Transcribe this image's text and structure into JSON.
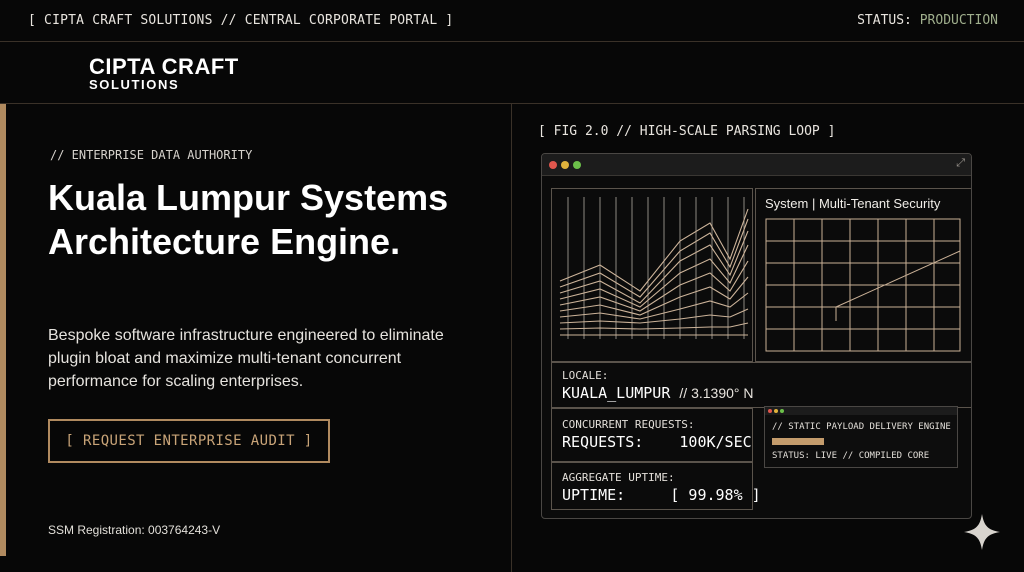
{
  "topbar": {
    "breadcrumb": "[ CIPTA CRAFT SOLUTIONS // CENTRAL CORPORATE PORTAL ]",
    "status_label": "STATUS:",
    "status_value": "PRODUCTION"
  },
  "logo": {
    "main": "CIPTA CRAFT",
    "sub": "SOLUTIONS"
  },
  "hero": {
    "eyebrow": "// ENTERPRISE DATA AUTHORITY",
    "headline": "Kuala Lumpur Systems Architecture Engine.",
    "description": "Bespoke software infrastructure engineered to eliminate plugin bloat and maximize multi-tenant concurrent performance for scaling enterprises.",
    "cta_label": "[ REQUEST ENTERPRISE AUDIT ]",
    "registration": "SSM Registration: 003764243-V"
  },
  "figure": {
    "caption": "[ FIG 2.0 // HIGH-SCALE PARSING LOOP ]",
    "security_title": "System | Multi-Tenant Security",
    "locale_label": "LOCALE:",
    "locale_value": "KUALA_LUMPUR",
    "locale_coord": "// 3.1390° N",
    "requests_label": "CONCURRENT REQUESTS:",
    "requests_value": "REQUESTS:    100K/SEC",
    "uptime_label": "AGGREGATE UPTIME:",
    "uptime_value": "UPTIME:     [ 99.98% ]",
    "engine_title": "// STATIC PAYLOAD DELIVERY ENGINE",
    "engine_status": "STATUS: LIVE // COMPILED CORE"
  },
  "icons": {
    "expand": "expand-icon",
    "spark": "sparkle-icon"
  },
  "colors": {
    "accent": "#b08a5f",
    "status_green": "#9fae8c",
    "background": "#070707"
  }
}
